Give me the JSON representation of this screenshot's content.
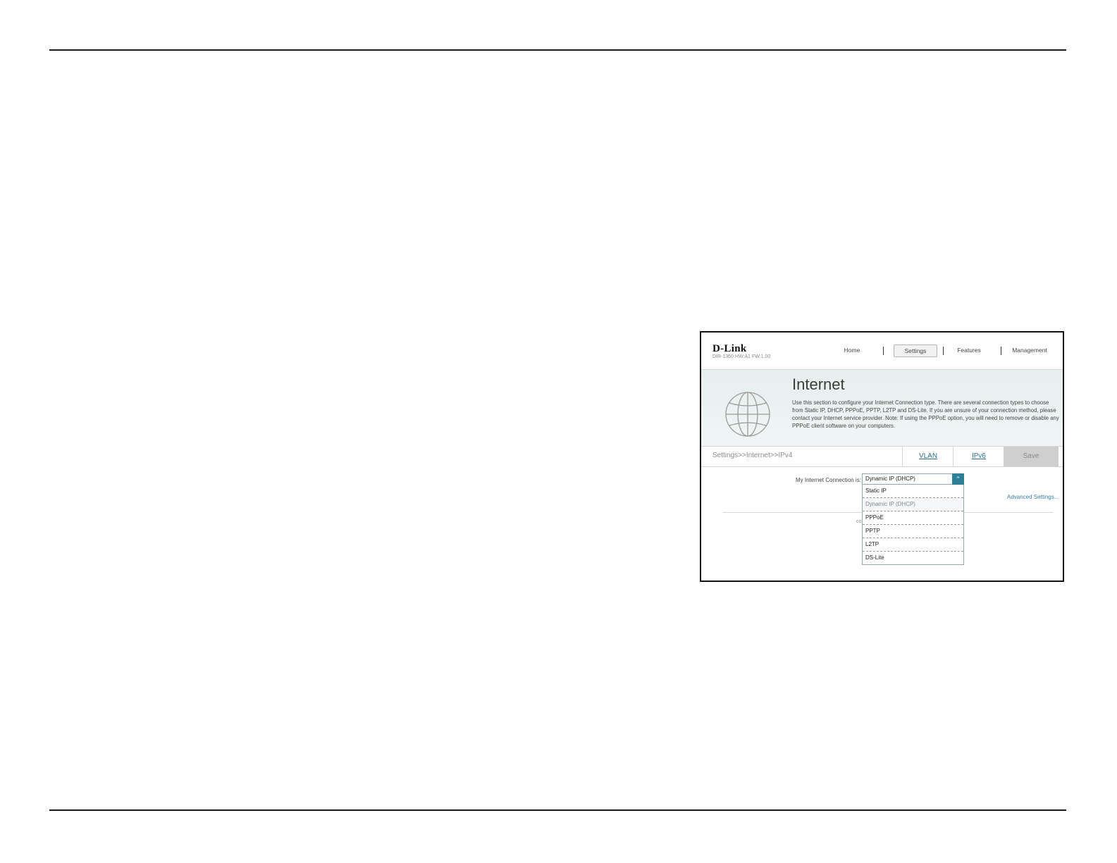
{
  "app": {
    "brand": "D-Link",
    "model_info": "DIR-1360 HW:A1 FW:1.00"
  },
  "nav": {
    "home": "Home",
    "settings": "Settings",
    "features": "Features",
    "management": "Management"
  },
  "banner": {
    "title": "Internet",
    "description": "Use this section to configure your Internet Connection type. There are several connection types to choose from Static IP, DHCP, PPPoE, PPTP, L2TP and DS-Lite. If you are unsure of your connection method, please contact your Internet service provider. Note: If using the PPPoE option, you will need to remove or disable any PPPoE client software on your computers."
  },
  "breadcrumb": "Settings>>Internet>>IPv4",
  "tabs": {
    "vlan": "VLAN",
    "ipv6": "IPv6",
    "save": "Save"
  },
  "form": {
    "connection_label": "My Internet Connection is:",
    "connection_value": "Dynamic IP (DHCP)",
    "advanced_link": "Advanced Settings...",
    "obscured_text": "co"
  },
  "dropdown_options": [
    "Static IP",
    "Dynamic IP (DHCP)",
    "PPPoE",
    "PPTP",
    "L2TP",
    "DS-Lite"
  ],
  "dropdown_selected_index": 1,
  "colors": {
    "accent": "#2f7f99",
    "link": "#2f6f8c",
    "banner_bg": "#e6eeee",
    "save_bg": "#cfcfcf"
  },
  "icons": {
    "globe": "globe-icon",
    "chevron": "chevron-up-icon"
  }
}
